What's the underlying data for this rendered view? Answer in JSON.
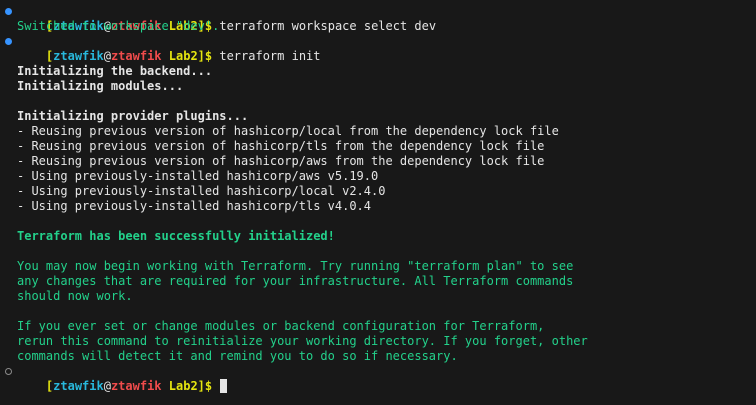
{
  "prompt": {
    "open_bracket": "[",
    "user": "ztawfik",
    "at": "@",
    "host": "ztawfik",
    "dir": "Lab2",
    "close": "]$"
  },
  "commands": {
    "first": "terraform workspace select dev",
    "second": "terraform init"
  },
  "output": {
    "switched": "Switched to workspace \"dev\".",
    "init_backend": "Initializing the backend...",
    "init_modules": "Initializing modules...",
    "init_plugins": "Initializing provider plugins...",
    "plugin_lines": [
      "- Reusing previous version of hashicorp/local from the dependency lock file",
      "- Reusing previous version of hashicorp/tls from the dependency lock file",
      "- Reusing previous version of hashicorp/aws from the dependency lock file",
      "- Using previously-installed hashicorp/aws v5.19.0",
      "- Using previously-installed hashicorp/local v2.4.0",
      "- Using previously-installed hashicorp/tls v4.0.4"
    ],
    "success": "Terraform has been successfully initialized!",
    "para1": [
      "You may now begin working with Terraform. Try running \"terraform plan\" to see",
      "any changes that are required for your infrastructure. All Terraform commands",
      "should now work."
    ],
    "para2": [
      "If you ever set or change modules or backend configuration for Terraform,",
      "rerun this command to reinitialize your working directory. If you forget, other",
      "commands will detect it and remind you to do so if necessary."
    ]
  },
  "colors": {
    "background": "#181818",
    "prompt_dir": "#e5e510",
    "prompt_host": "#f14c4c",
    "success_green": "#23d18b",
    "marker_active": "#3794ff"
  }
}
